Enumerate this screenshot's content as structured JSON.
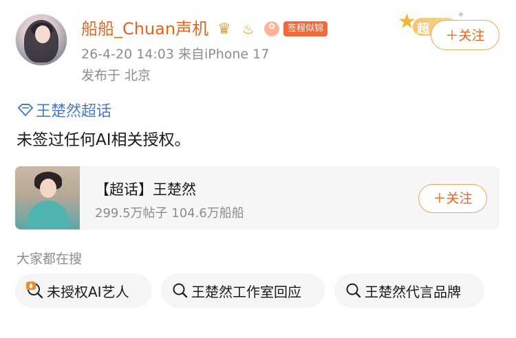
{
  "post": {
    "username": "船船_Chuan声机",
    "sign_label": "签程似锦",
    "meta": "26-4-20 14:03  来自iPhone 17",
    "location": "发布于 北京",
    "super_badge": "超",
    "follow_label": "＋关注"
  },
  "topic": {
    "name": "王楚然超话",
    "text": "未签过任何AI相关授权。"
  },
  "card": {
    "title": "【超话】王楚然",
    "stats": "299.5万帖子 104.6万船船",
    "follow_label": "＋关注"
  },
  "search": {
    "label": "大家都在搜",
    "items": [
      {
        "text": "未授权AI艺人",
        "icon": "hot-search-icon"
      },
      {
        "text": "王楚然工作室回应",
        "icon": "search-icon"
      },
      {
        "text": "王楚然代言品牌",
        "icon": "search-icon"
      }
    ]
  },
  "colors": {
    "accent": "#e8641b",
    "link": "#4a79c9",
    "muted": "#8c8c8c"
  }
}
